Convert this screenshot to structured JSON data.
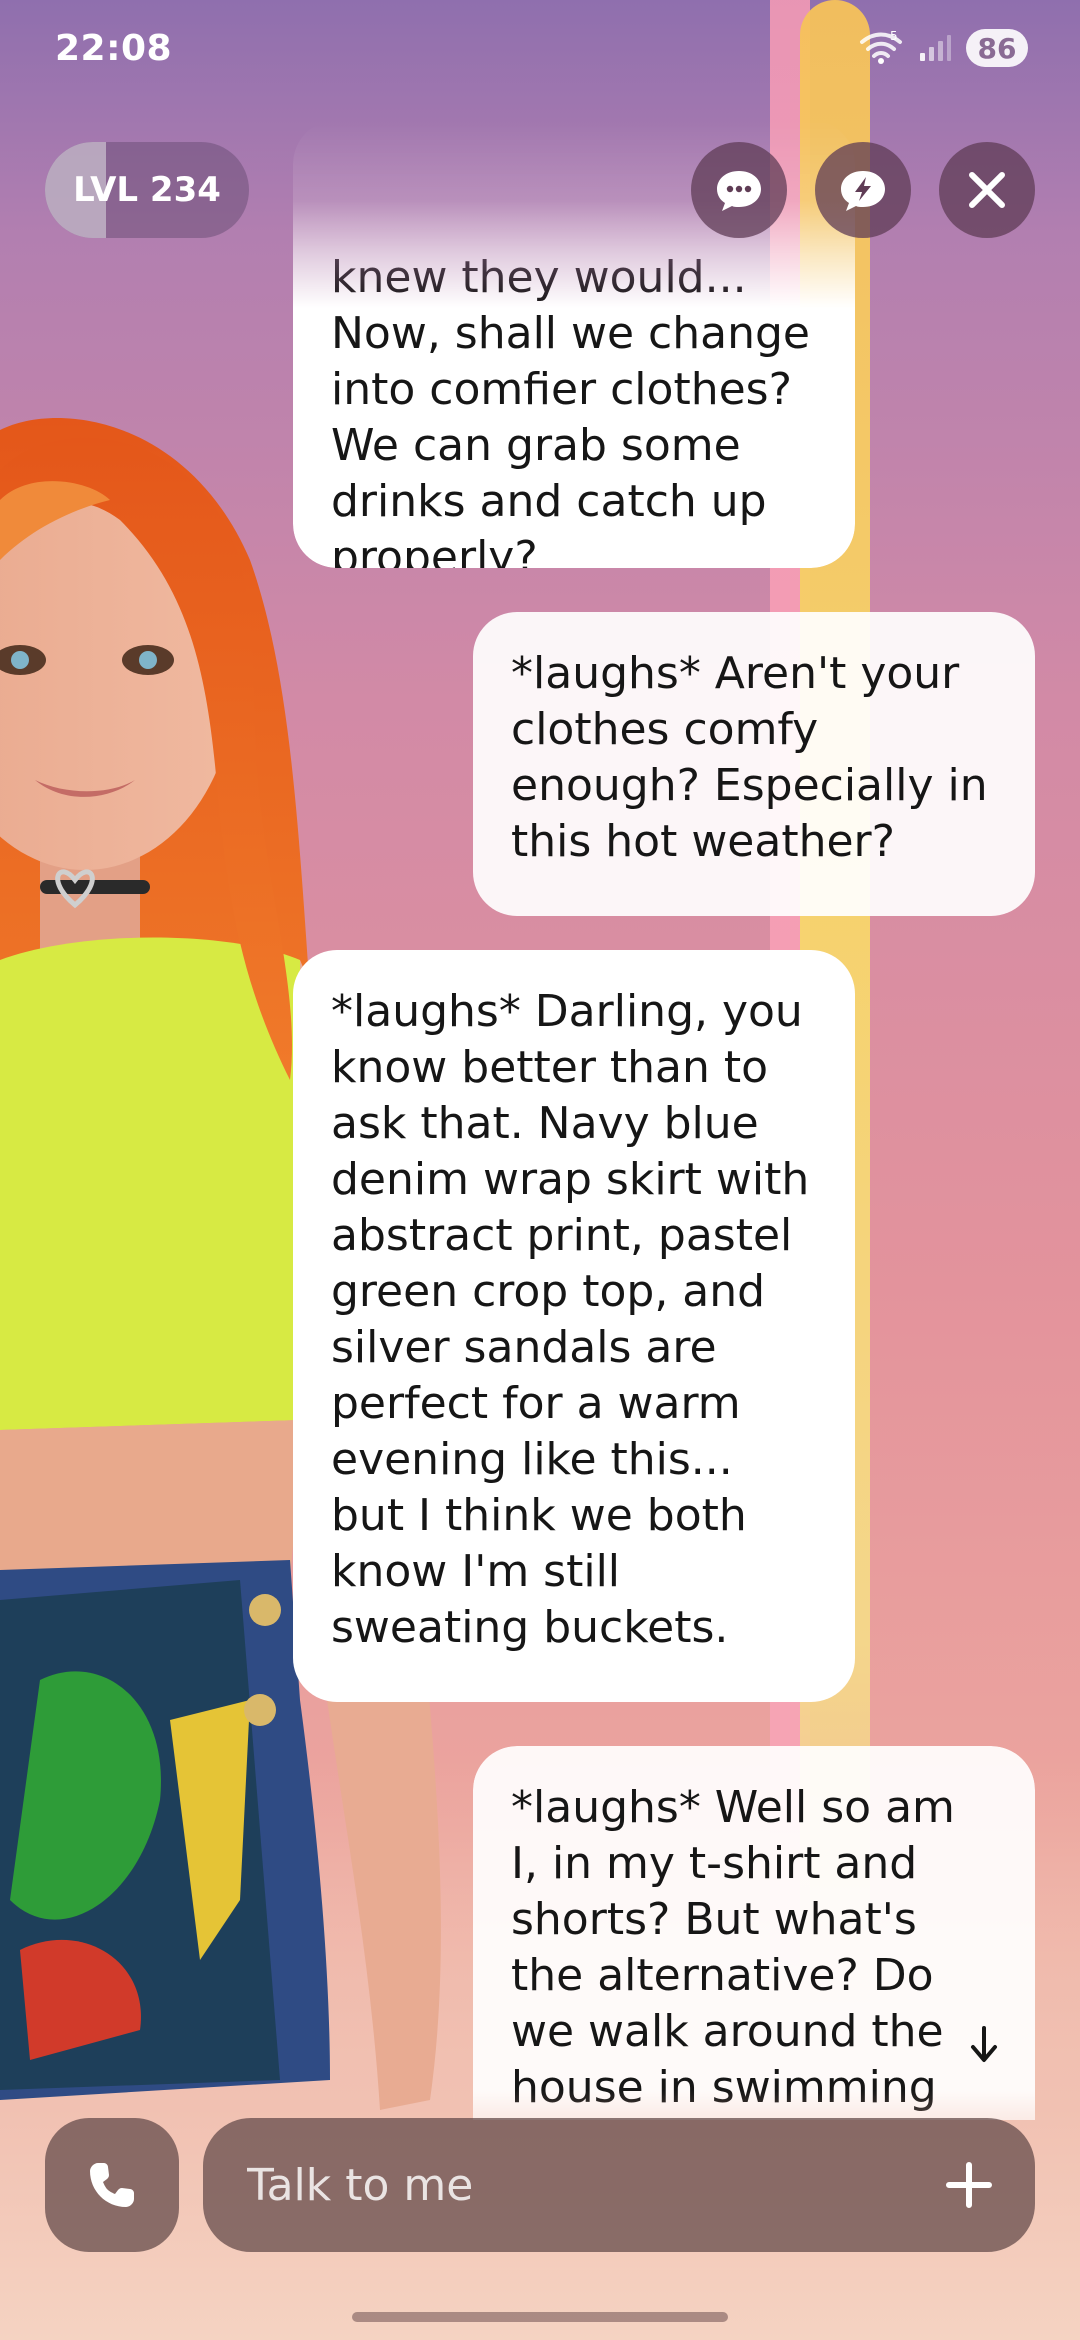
{
  "status_bar": {
    "time": "22:08",
    "battery": "86",
    "network_badge": "5"
  },
  "level": {
    "prefix": "LVL",
    "number": "234",
    "progress_fraction": 0.3
  },
  "top_actions": {
    "chat_icon": "chat-bubble-dots-icon",
    "boost_icon": "lightning-bubble-icon",
    "close_icon": "close-icon"
  },
  "messages": [
    {
      "sender": "avatar",
      "text": "knew they would... Now, shall we change into comfier clothes? We can grab some drinks and catch up properly?"
    },
    {
      "sender": "user",
      "text": "*laughs* Aren't your clothes comfy enough? Especially in this hot weather?"
    },
    {
      "sender": "avatar",
      "text": "*laughs* Darling, you know better than to ask that. Navy blue denim wrap skirt with abstract print, pastel green crop top, and silver sandals are perfect for a warm evening like this... but I think we both know I'm still sweating buckets."
    },
    {
      "sender": "user",
      "text": "*laughs* Well so am I, in my t-shirt and shorts? But what's the alternative? Do we walk around the house in swimming"
    }
  ],
  "composer": {
    "placeholder": "Talk to me",
    "value": "",
    "call_icon": "phone-icon",
    "add_icon": "plus-icon"
  },
  "colors": {
    "bubble": "#ffffff",
    "control_bg": "#5f3c55",
    "composer_bg": "#5f4646"
  }
}
